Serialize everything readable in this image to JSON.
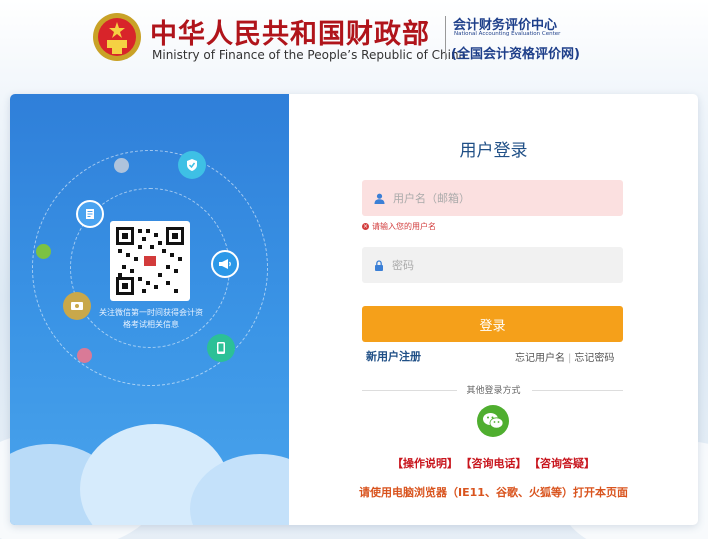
{
  "header": {
    "ministry_cn": "中华人民共和国财政部",
    "ministry_en": "Ministry of Finance of the People’s Republic of China",
    "center_cn": "会计财务评价中心",
    "center_en": "National Accounting Evaluation Center",
    "center_sub": "(全国会计资格评价网)"
  },
  "promo": {
    "qr_caption": "关注微信第一时间获得会计资格考试相关信息"
  },
  "login": {
    "title": "用户登录",
    "username_placeholder": "用户名（邮箱）",
    "username_error": "请输入您的用户名",
    "password_placeholder": "密码",
    "login_button": "登录",
    "register": "新用户注册",
    "forgot_username": "忘记用户名",
    "forgot_password": "忘记密码",
    "other_methods": "其他登录方式",
    "other_method_icon": "wechat-icon"
  },
  "footer_links": {
    "operation_guide": "【操作说明】",
    "hotline": "【咨询电话】",
    "faq": "【咨询答疑】"
  },
  "browser_tip": "请使用电脑浏览器（IE11、谷歌、火狐等）打开本页面",
  "colors": {
    "brand_red": "#b0141b",
    "navy": "#1e3f8a",
    "login_orange": "#f5a01a",
    "panel_blue": "#3b8fe3",
    "wechat_green": "#4fae2f",
    "link_red": "#c8151d"
  }
}
